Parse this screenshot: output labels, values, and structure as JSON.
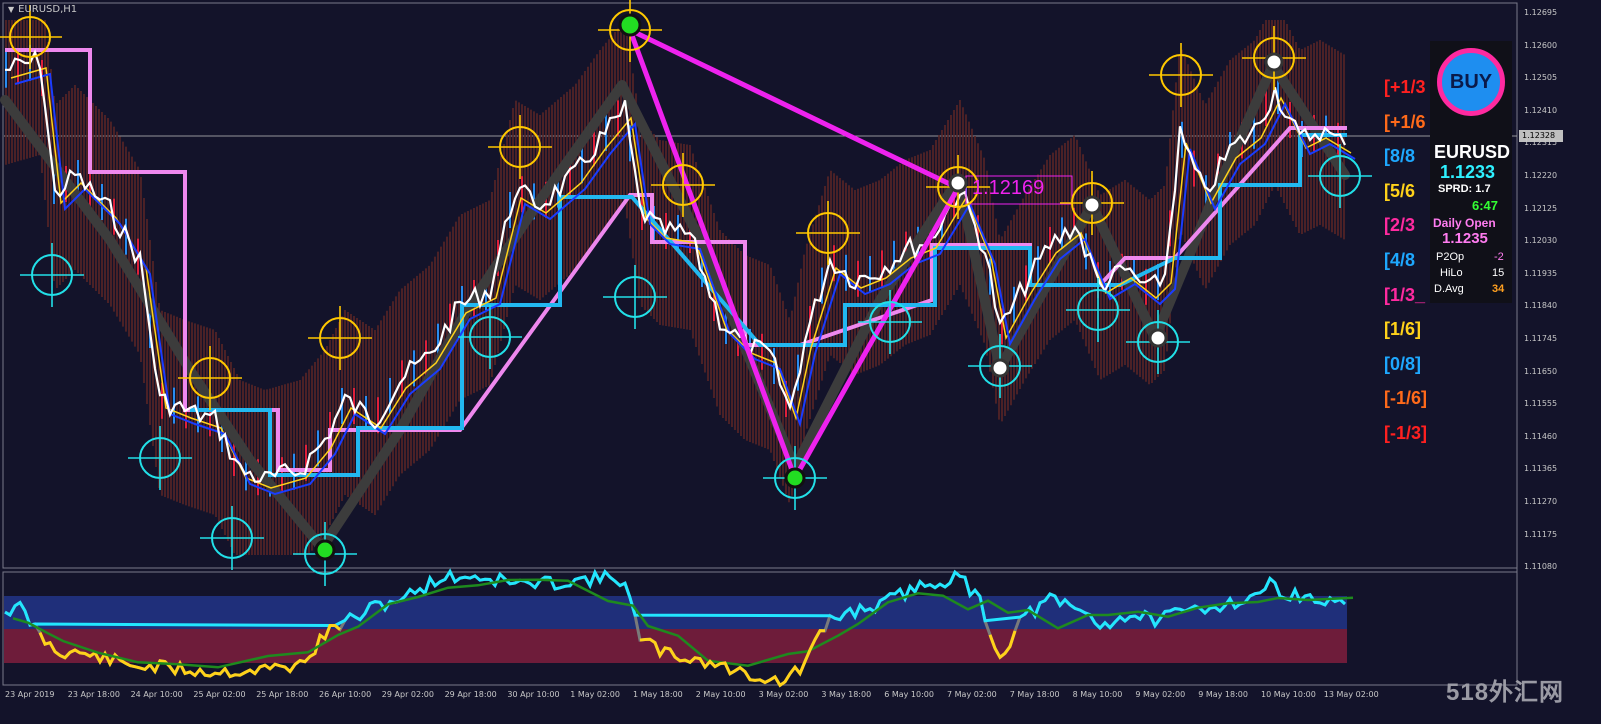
{
  "chart": {
    "symbol_title": "EURUSD,H1",
    "line_label": "1.12169",
    "current_price_tag": "1.12328"
  },
  "price_axis": [
    "1.12695",
    "1.12600",
    "1.12505",
    "1.12410",
    "1.12315",
    "1.12220",
    "1.12125",
    "1.12030",
    "1.11935",
    "1.11840",
    "1.11745",
    "1.11650",
    "1.11555",
    "1.11460",
    "1.11365",
    "1.11270",
    "1.11175",
    "1.11080"
  ],
  "time_axis": [
    "23 Apr 2019",
    "23 Apr 18:00",
    "24 Apr 10:00",
    "25 Apr 02:00",
    "25 Apr 18:00",
    "26 Apr 10:00",
    "29 Apr 02:00",
    "29 Apr 18:00",
    "30 Apr 10:00",
    "1 May 02:00",
    "1 May 18:00",
    "2 May 10:00",
    "3 May 02:00",
    "3 May 18:00",
    "6 May 10:00",
    "7 May 02:00",
    "7 May 18:00",
    "8 May 10:00",
    "9 May 02:00",
    "9 May 18:00",
    "10 May 10:00",
    "13 May 02:00"
  ],
  "murrey_levels": [
    {
      "label": "[+1/3",
      "color": "#ff2020"
    },
    {
      "label": "[+1/6",
      "color": "#ff6a1a"
    },
    {
      "label": "[8/8",
      "color": "#1ea8ff"
    },
    {
      "label": "[5/6",
      "color": "#ffd21a"
    },
    {
      "label": "[2/3",
      "color": "#ff2aa0"
    },
    {
      "label": "[4/8",
      "color": "#1ea8ff"
    },
    {
      "label": "[1/3_",
      "color": "#ff2aa0"
    },
    {
      "label": "[1/6]",
      "color": "#ffd21a"
    },
    {
      "label": "[0/8]",
      "color": "#1ea8ff"
    },
    {
      "label": "[-1/6]",
      "color": "#ff6a1a"
    },
    {
      "label": "[-1/3]",
      "color": "#ff2020"
    }
  ],
  "panel": {
    "signal": "BUY",
    "symbol": "EURUSD",
    "price": "1.1233",
    "spread": "SPRD: 1.7",
    "timer": "6:47",
    "daily_open_label": "Daily Open",
    "daily_open_value": "1.1235",
    "stats": [
      {
        "label": "P2Op",
        "value": "-2"
      },
      {
        "label": "HiLo",
        "value": "15"
      },
      {
        "label": "D.Avg",
        "value": "34"
      }
    ]
  },
  "watermark": "518外汇网",
  "colors": {
    "background": "#13132a",
    "zigzag": "#3c3c3c",
    "triangle": "#ee22ee",
    "price_line": "#ffffff",
    "band": "#4a1f1f",
    "top_target": "#ffc800",
    "bottom_target": "#22e0e8"
  }
}
